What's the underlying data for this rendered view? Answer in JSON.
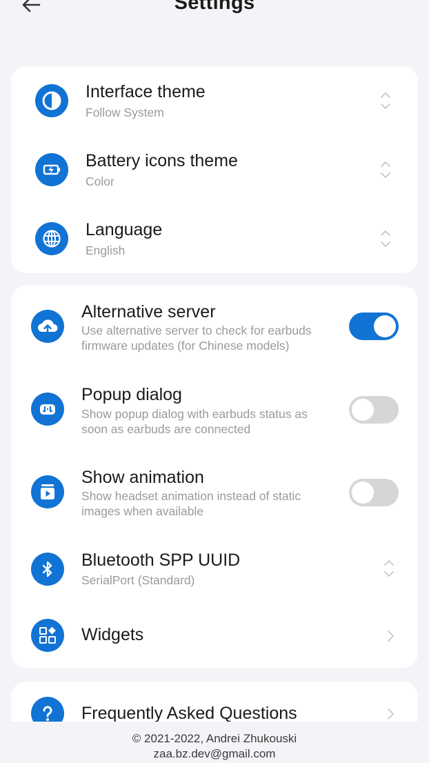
{
  "header": {
    "title": "Settings"
  },
  "card1": {
    "items": [
      {
        "title": "Interface theme",
        "subtitle": "Follow System",
        "icon": "half-circle-icon"
      },
      {
        "title": "Battery icons theme",
        "subtitle": "Color",
        "icon": "battery-charging-icon"
      },
      {
        "title": "Language",
        "subtitle": "English",
        "icon": "globe-icon"
      }
    ]
  },
  "card2": {
    "alt_server": {
      "title": "Alternative server",
      "sub1": "Use alternative server to check for earbuds",
      "sub2": "firmware updates (for Chinese models)",
      "enabled": true,
      "icon": "cloud-upload-icon"
    },
    "popup": {
      "title": "Popup dialog",
      "sub1": "Show popup dialog with earbuds status as",
      "sub2": "soon as earbuds are connected",
      "enabled": false,
      "icon": "earbuds-case-icon"
    },
    "animation": {
      "title": "Show animation",
      "sub1": "Show headset animation instead of static",
      "sub2": "images when available",
      "enabled": false,
      "icon": "play-video-icon"
    },
    "uuid": {
      "title": "Bluetooth SPP UUID",
      "subtitle": "SerialPort (Standard)",
      "icon": "bluetooth-icon"
    },
    "widgets": {
      "title": "Widgets",
      "icon": "widgets-icon"
    }
  },
  "card3": {
    "faq": {
      "title": "Frequently Asked Questions",
      "icon": "question-icon"
    }
  },
  "footer": {
    "copyright": "© 2021-2022, Andrei Zhukouski",
    "email": "zaa.bz.dev@gmail.com"
  },
  "colors": {
    "accent": "#1173d4",
    "background": "#f4f3f7",
    "card": "#ffffff",
    "subtitle": "#9a9a9a"
  }
}
